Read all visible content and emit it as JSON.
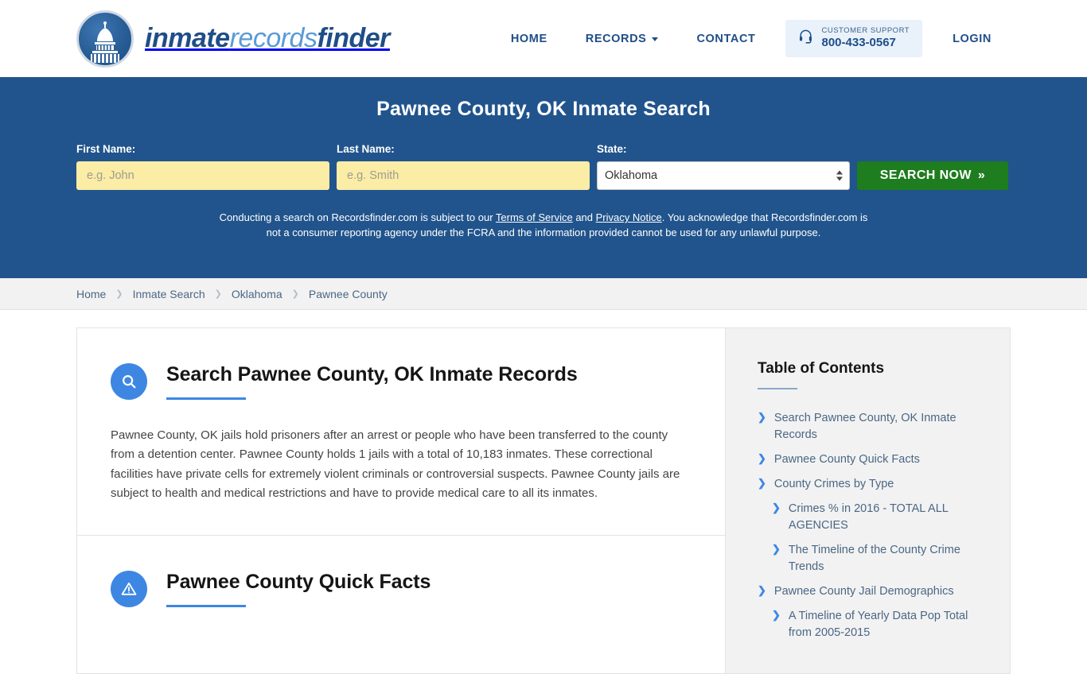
{
  "header": {
    "logo": {
      "icon": "capitol-dome-icon",
      "part1": "inmate",
      "part2": "records",
      "part3": "finder"
    },
    "nav": [
      {
        "label": "HOME",
        "name": "nav-home"
      },
      {
        "label": "RECORDS",
        "name": "nav-records",
        "has_chevron": true
      },
      {
        "label": "CONTACT",
        "name": "nav-contact"
      }
    ],
    "support": {
      "icon": "headset-icon",
      "title": "CUSTOMER SUPPORT",
      "phone": "800-433-0567",
      "bg": "#e9f2fb"
    },
    "login_label": "LOGIN"
  },
  "hero": {
    "bg": "#21548c",
    "title": "Pawnee County, OK Inmate Search",
    "first_name": {
      "label": "First Name:",
      "value": "",
      "placeholder": "e.g. John"
    },
    "last_name": {
      "label": "Last Name:",
      "value": "",
      "placeholder": "e.g. Smith"
    },
    "state": {
      "label": "State:",
      "value": "Oklahoma",
      "options": [
        "Oklahoma"
      ]
    },
    "search_button": {
      "label": "SEARCH NOW",
      "glyph": "»",
      "color": "#1e7d1e"
    },
    "disclaimer": {
      "part1": "Conducting a search on Recordsfinder.com is subject to our ",
      "link1": "Terms of Service",
      "part2": " and ",
      "link2": "Privacy Notice",
      "part3": ". You acknowledge that Recordsfinder.com is not a consumer reporting agency under the FCRA and the information provided cannot be used for any unlawful purpose."
    }
  },
  "breadcrumb": {
    "separator": "❯",
    "items": [
      {
        "label": "Home"
      },
      {
        "label": "Inmate Search"
      },
      {
        "label": "Oklahoma"
      },
      {
        "label": "Pawnee County"
      }
    ]
  },
  "main": {
    "sections": [
      {
        "icon": "search-icon",
        "title": "Search Pawnee County, OK Inmate Records",
        "body": "Pawnee County, OK jails hold prisoners after an arrest or people who have been transferred to the county from a detention center. Pawnee County holds 1 jails with a total of 10,183 inmates. These correctional facilities have private cells for extremely violent criminals or controversial suspects. Pawnee County jails are subject to health and medical restrictions and have to provide medical care to all its inmates."
      },
      {
        "icon": "alert-triangle-icon",
        "title": "Pawnee County Quick Facts",
        "body": ""
      }
    ]
  },
  "toc": {
    "title": "Table of Contents",
    "items": [
      {
        "label": "Search Pawnee County, OK Inmate Records",
        "nested": false
      },
      {
        "label": "Pawnee County Quick Facts",
        "nested": false
      },
      {
        "label": "County Crimes by Type",
        "nested": false
      },
      {
        "label": "Crimes % in 2016 - TOTAL ALL AGENCIES",
        "nested": true
      },
      {
        "label": "The Timeline of the County Crime Trends",
        "nested": true
      },
      {
        "label": "Pawnee County Jail Demographics",
        "nested": false
      },
      {
        "label": "A Timeline of Yearly Data Pop Total from 2005-2015",
        "nested": true
      }
    ]
  }
}
